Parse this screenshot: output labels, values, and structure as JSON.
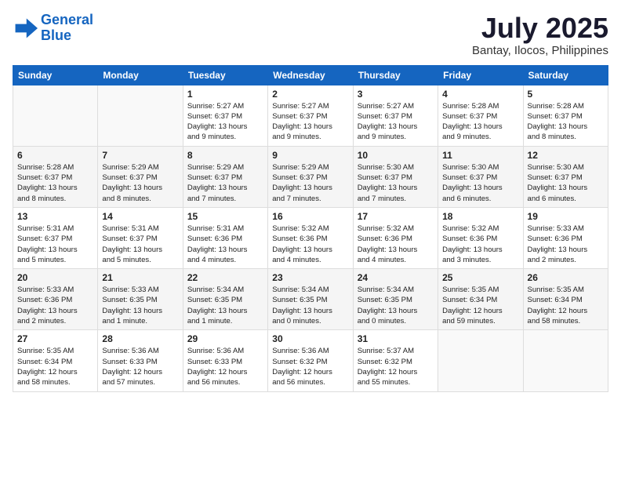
{
  "header": {
    "logo_line1": "General",
    "logo_line2": "Blue",
    "month_year": "July 2025",
    "location": "Bantay, Ilocos, Philippines"
  },
  "weekdays": [
    "Sunday",
    "Monday",
    "Tuesday",
    "Wednesday",
    "Thursday",
    "Friday",
    "Saturday"
  ],
  "weeks": [
    [
      {
        "day": "",
        "detail": ""
      },
      {
        "day": "",
        "detail": ""
      },
      {
        "day": "1",
        "detail": "Sunrise: 5:27 AM\nSunset: 6:37 PM\nDaylight: 13 hours\nand 9 minutes."
      },
      {
        "day": "2",
        "detail": "Sunrise: 5:27 AM\nSunset: 6:37 PM\nDaylight: 13 hours\nand 9 minutes."
      },
      {
        "day": "3",
        "detail": "Sunrise: 5:27 AM\nSunset: 6:37 PM\nDaylight: 13 hours\nand 9 minutes."
      },
      {
        "day": "4",
        "detail": "Sunrise: 5:28 AM\nSunset: 6:37 PM\nDaylight: 13 hours\nand 9 minutes."
      },
      {
        "day": "5",
        "detail": "Sunrise: 5:28 AM\nSunset: 6:37 PM\nDaylight: 13 hours\nand 8 minutes."
      }
    ],
    [
      {
        "day": "6",
        "detail": "Sunrise: 5:28 AM\nSunset: 6:37 PM\nDaylight: 13 hours\nand 8 minutes."
      },
      {
        "day": "7",
        "detail": "Sunrise: 5:29 AM\nSunset: 6:37 PM\nDaylight: 13 hours\nand 8 minutes."
      },
      {
        "day": "8",
        "detail": "Sunrise: 5:29 AM\nSunset: 6:37 PM\nDaylight: 13 hours\nand 7 minutes."
      },
      {
        "day": "9",
        "detail": "Sunrise: 5:29 AM\nSunset: 6:37 PM\nDaylight: 13 hours\nand 7 minutes."
      },
      {
        "day": "10",
        "detail": "Sunrise: 5:30 AM\nSunset: 6:37 PM\nDaylight: 13 hours\nand 7 minutes."
      },
      {
        "day": "11",
        "detail": "Sunrise: 5:30 AM\nSunset: 6:37 PM\nDaylight: 13 hours\nand 6 minutes."
      },
      {
        "day": "12",
        "detail": "Sunrise: 5:30 AM\nSunset: 6:37 PM\nDaylight: 13 hours\nand 6 minutes."
      }
    ],
    [
      {
        "day": "13",
        "detail": "Sunrise: 5:31 AM\nSunset: 6:37 PM\nDaylight: 13 hours\nand 5 minutes."
      },
      {
        "day": "14",
        "detail": "Sunrise: 5:31 AM\nSunset: 6:37 PM\nDaylight: 13 hours\nand 5 minutes."
      },
      {
        "day": "15",
        "detail": "Sunrise: 5:31 AM\nSunset: 6:36 PM\nDaylight: 13 hours\nand 4 minutes."
      },
      {
        "day": "16",
        "detail": "Sunrise: 5:32 AM\nSunset: 6:36 PM\nDaylight: 13 hours\nand 4 minutes."
      },
      {
        "day": "17",
        "detail": "Sunrise: 5:32 AM\nSunset: 6:36 PM\nDaylight: 13 hours\nand 4 minutes."
      },
      {
        "day": "18",
        "detail": "Sunrise: 5:32 AM\nSunset: 6:36 PM\nDaylight: 13 hours\nand 3 minutes."
      },
      {
        "day": "19",
        "detail": "Sunrise: 5:33 AM\nSunset: 6:36 PM\nDaylight: 13 hours\nand 2 minutes."
      }
    ],
    [
      {
        "day": "20",
        "detail": "Sunrise: 5:33 AM\nSunset: 6:36 PM\nDaylight: 13 hours\nand 2 minutes."
      },
      {
        "day": "21",
        "detail": "Sunrise: 5:33 AM\nSunset: 6:35 PM\nDaylight: 13 hours\nand 1 minute."
      },
      {
        "day": "22",
        "detail": "Sunrise: 5:34 AM\nSunset: 6:35 PM\nDaylight: 13 hours\nand 1 minute."
      },
      {
        "day": "23",
        "detail": "Sunrise: 5:34 AM\nSunset: 6:35 PM\nDaylight: 13 hours\nand 0 minutes."
      },
      {
        "day": "24",
        "detail": "Sunrise: 5:34 AM\nSunset: 6:35 PM\nDaylight: 13 hours\nand 0 minutes."
      },
      {
        "day": "25",
        "detail": "Sunrise: 5:35 AM\nSunset: 6:34 PM\nDaylight: 12 hours\nand 59 minutes."
      },
      {
        "day": "26",
        "detail": "Sunrise: 5:35 AM\nSunset: 6:34 PM\nDaylight: 12 hours\nand 58 minutes."
      }
    ],
    [
      {
        "day": "27",
        "detail": "Sunrise: 5:35 AM\nSunset: 6:34 PM\nDaylight: 12 hours\nand 58 minutes."
      },
      {
        "day": "28",
        "detail": "Sunrise: 5:36 AM\nSunset: 6:33 PM\nDaylight: 12 hours\nand 57 minutes."
      },
      {
        "day": "29",
        "detail": "Sunrise: 5:36 AM\nSunset: 6:33 PM\nDaylight: 12 hours\nand 56 minutes."
      },
      {
        "day": "30",
        "detail": "Sunrise: 5:36 AM\nSunset: 6:32 PM\nDaylight: 12 hours\nand 56 minutes."
      },
      {
        "day": "31",
        "detail": "Sunrise: 5:37 AM\nSunset: 6:32 PM\nDaylight: 12 hours\nand 55 minutes."
      },
      {
        "day": "",
        "detail": ""
      },
      {
        "day": "",
        "detail": ""
      }
    ]
  ]
}
